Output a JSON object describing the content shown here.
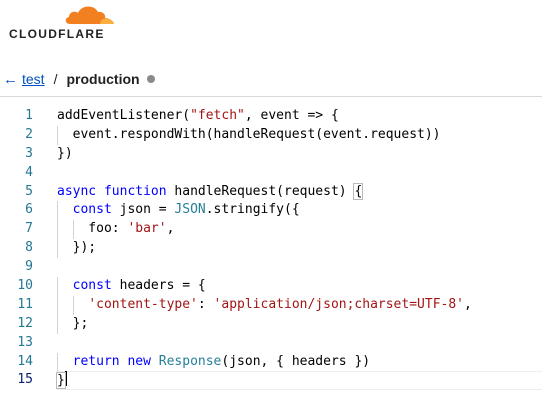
{
  "brand": {
    "name": "CLOUDFLARE",
    "accent": "#f38020"
  },
  "breadcrumb": {
    "back_icon": "←",
    "project": "test",
    "separator": "/",
    "environment": "production",
    "status_color": "#8a8a8a"
  },
  "editor": {
    "lines": [
      {
        "num": "1",
        "tokens": [
          [
            "default",
            "addEventListener("
          ],
          [
            "string",
            "\"fetch\""
          ],
          [
            "default",
            ", event => {"
          ]
        ]
      },
      {
        "num": "2",
        "tokens": [
          [
            "default",
            "  event.respondWith(handleRequest(event.request))"
          ]
        ]
      },
      {
        "num": "3",
        "tokens": [
          [
            "default",
            "})"
          ]
        ]
      },
      {
        "num": "4",
        "tokens": []
      },
      {
        "num": "5",
        "tokens": [
          [
            "keyword",
            "async"
          ],
          [
            "default",
            " "
          ],
          [
            "keyword",
            "function"
          ],
          [
            "default",
            " handleRequest(request) "
          ],
          [
            "bracket-match",
            "{"
          ]
        ]
      },
      {
        "num": "6",
        "tokens": [
          [
            "default",
            "  "
          ],
          [
            "keyword",
            "const"
          ],
          [
            "default",
            " json = "
          ],
          [
            "type",
            "JSON"
          ],
          [
            "default",
            ".stringify({"
          ]
        ]
      },
      {
        "num": "7",
        "tokens": [
          [
            "default",
            "    foo: "
          ],
          [
            "string",
            "'bar'"
          ],
          [
            "default",
            ","
          ]
        ]
      },
      {
        "num": "8",
        "tokens": [
          [
            "default",
            "  });"
          ]
        ]
      },
      {
        "num": "9",
        "tokens": []
      },
      {
        "num": "10",
        "tokens": [
          [
            "default",
            "  "
          ],
          [
            "keyword",
            "const"
          ],
          [
            "default",
            " headers = {"
          ]
        ]
      },
      {
        "num": "11",
        "tokens": [
          [
            "default",
            "    "
          ],
          [
            "string",
            "'content-type'"
          ],
          [
            "default",
            ": "
          ],
          [
            "string",
            "'application/json;charset=UTF-8'"
          ],
          [
            "default",
            ","
          ]
        ]
      },
      {
        "num": "12",
        "tokens": [
          [
            "default",
            "  };"
          ]
        ]
      },
      {
        "num": "13",
        "tokens": []
      },
      {
        "num": "14",
        "tokens": [
          [
            "default",
            "  "
          ],
          [
            "keyword",
            "return"
          ],
          [
            "default",
            " "
          ],
          [
            "keyword",
            "new"
          ],
          [
            "default",
            " "
          ],
          [
            "type",
            "Response"
          ],
          [
            "default",
            "(json, { headers })"
          ]
        ]
      },
      {
        "num": "15",
        "tokens": [
          [
            "bracket-match",
            "}"
          ]
        ],
        "active": true
      }
    ]
  }
}
